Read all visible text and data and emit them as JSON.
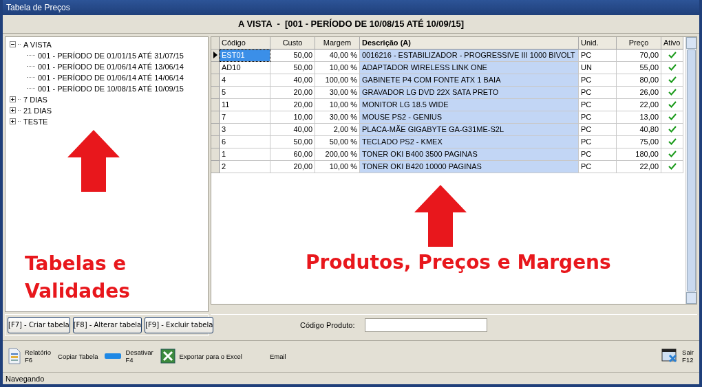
{
  "window": {
    "title": "Tabela de Preços"
  },
  "header": "A VISTA  -  [001 - PERÍODO DE 10/08/15 ATÉ 10/09/15]",
  "tree": [
    {
      "label": "A VISTA",
      "expanded": true,
      "children": [
        {
          "label": "001 - PERÍODO DE 01/01/15 ATÉ 31/07/15"
        },
        {
          "label": "001 - PERÍODO DE 01/06/14 ATÉ 13/06/14"
        },
        {
          "label": "001 - PERÍODO DE 01/06/14 ATÉ 14/06/14"
        },
        {
          "label": "001 - PERÍODO DE 10/08/15 ATÉ 10/09/15"
        }
      ]
    },
    {
      "label": "7 DIAS",
      "expanded": false
    },
    {
      "label": "21 DIAS",
      "expanded": false
    },
    {
      "label": "TESTE",
      "expanded": false
    }
  ],
  "left_annotation": "Tabelas e Validades",
  "right_annotation": "Produtos, Preços e Margens",
  "left_buttons": [
    "[F7] - Criar tabela",
    "[F8] - Alterar tabela",
    "[F9] - Excluir tabela"
  ],
  "table": {
    "columns": [
      "Código",
      "Custo",
      "Margem",
      "Descrição (A)",
      "Unid.",
      "Preço",
      "Ativo"
    ],
    "rows": [
      {
        "selected": true,
        "cells": [
          "EST01",
          "50,00",
          "40,00 %",
          "0016216 - ESTABILIZADOR -  PROGRESSIVE III 1000 BIVOLT",
          "PC",
          "70,00"
        ],
        "checked": true
      },
      {
        "selected": false,
        "cells": [
          "AD10",
          "50,00",
          "10,00 %",
          "ADAPTADOR WIRELESS LINK ONE",
          "UN",
          "55,00"
        ],
        "checked": true
      },
      {
        "selected": false,
        "cells": [
          "4",
          "40,00",
          "100,00 %",
          "GABINETE P4 COM FONTE ATX 1 BAIA",
          "PC",
          "80,00"
        ],
        "checked": true
      },
      {
        "selected": false,
        "cells": [
          "5",
          "20,00",
          "30,00 %",
          "GRAVADOR LG DVD 22X SATA PRETO",
          "PC",
          "26,00"
        ],
        "checked": true
      },
      {
        "selected": false,
        "cells": [
          "11",
          "20,00",
          "10,00 %",
          "MONITOR LG 18.5 WIDE",
          "PC",
          "22,00"
        ],
        "checked": true
      },
      {
        "selected": false,
        "cells": [
          "7",
          "10,00",
          "30,00 %",
          "MOUSE PS2 - GENIUS",
          "PC",
          "13,00"
        ],
        "checked": true
      },
      {
        "selected": false,
        "cells": [
          "3",
          "40,00",
          "2,00 %",
          "PLACA-MÃE GIGABYTE GA-G31ME-S2L",
          "PC",
          "40,80"
        ],
        "checked": true
      },
      {
        "selected": false,
        "cells": [
          "6",
          "50,00",
          "50,00 %",
          "TECLADO PS2 - KMEX",
          "PC",
          "75,00"
        ],
        "checked": true
      },
      {
        "selected": false,
        "cells": [
          "1",
          "60,00",
          "200,00 %",
          "TONER OKI B400 3500 PAGINAS",
          "PC",
          "180,00"
        ],
        "checked": true
      },
      {
        "selected": false,
        "cells": [
          "2",
          "20,00",
          "10,00 %",
          "TONER OKI B420 10000 PAGINAS",
          "PC",
          "22,00"
        ],
        "checked": true
      }
    ]
  },
  "product_code": {
    "label": "Código Produto:"
  },
  "toolbar": [
    {
      "kind": "report",
      "lines": [
        "Relatório",
        "F6"
      ]
    },
    {
      "kind": "text",
      "lines": [
        "Copiar Tabela"
      ]
    },
    {
      "kind": "bar",
      "lines": [
        "Desativar",
        "F4"
      ]
    },
    {
      "kind": "excel",
      "lines": [
        "Exportar para o Excel"
      ]
    },
    {
      "kind": "text",
      "lines": [
        "Email"
      ]
    },
    {
      "kind": "exit",
      "lines": [
        "Sair",
        "F12"
      ]
    }
  ],
  "status_bar": "Navegando"
}
